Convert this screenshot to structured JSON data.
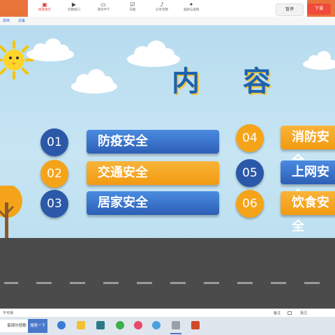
{
  "toolbar": {
    "items": [
      {
        "label": "结束演示",
        "icon": "screen-share-icon"
      },
      {
        "label": "切换窗口",
        "icon": "window-switch-icon"
      },
      {
        "label": "演示PPT",
        "icon": "ppt-icon"
      },
      {
        "label": "白板",
        "icon": "whiteboard-icon"
      },
      {
        "label": "分享音频",
        "icon": "audio-share-icon"
      },
      {
        "label": "美颜与滤镜",
        "icon": "beauty-filter-icon"
      }
    ],
    "pause_label": "暂停",
    "stage_label": "下课"
  },
  "meeting_bar": {
    "item1": "投映",
    "item2": "设备"
  },
  "slide": {
    "title": "内 容",
    "colors": {
      "blue": "#2b58a8",
      "orange": "#f5a41a",
      "title": "#1d62b0"
    },
    "items": [
      {
        "num": "01",
        "label": "防疫安全",
        "color": "blue"
      },
      {
        "num": "02",
        "label": "交通安全",
        "color": "orange"
      },
      {
        "num": "03",
        "label": "居家安全",
        "color": "blue"
      },
      {
        "num": "04",
        "label": "消防安全",
        "color": "orange"
      },
      {
        "num": "05",
        "label": "上网安全",
        "color": "blue"
      },
      {
        "num": "06",
        "label": "饮食安全",
        "color": "orange"
      }
    ]
  },
  "status": {
    "left_text": "不可用",
    "note_label": "备注",
    "comment_label": "批注"
  },
  "taskbar": {
    "app_label": "家闻尔扭歌",
    "search_label": "搜索一下"
  }
}
